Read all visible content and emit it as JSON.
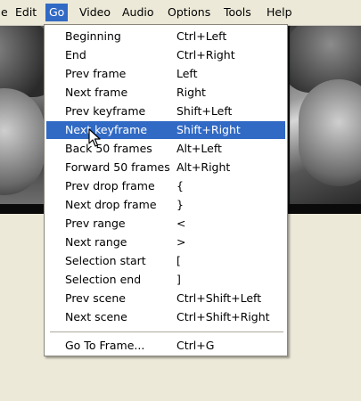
{
  "menubar": {
    "items": [
      {
        "label": "e"
      },
      {
        "label": "Edit"
      },
      {
        "label": "Go"
      },
      {
        "label": "Video"
      },
      {
        "label": "Audio"
      },
      {
        "label": "Options"
      },
      {
        "label": "Tools"
      },
      {
        "label": "Help"
      }
    ],
    "active_index": 2
  },
  "go_menu": {
    "items": [
      {
        "label": "Beginning",
        "shortcut": "Ctrl+Left"
      },
      {
        "label": "End",
        "shortcut": "Ctrl+Right"
      },
      {
        "label": "Prev frame",
        "shortcut": "Left"
      },
      {
        "label": "Next frame",
        "shortcut": "Right"
      },
      {
        "label": "Prev keyframe",
        "shortcut": "Shift+Left"
      },
      {
        "label": "Next keyframe",
        "shortcut": "Shift+Right"
      },
      {
        "label": "Back 50 frames",
        "shortcut": "Alt+Left"
      },
      {
        "label": "Forward 50 frames",
        "shortcut": "Alt+Right"
      },
      {
        "label": "Prev drop frame",
        "shortcut": "{"
      },
      {
        "label": "Next drop frame",
        "shortcut": "}"
      },
      {
        "label": "Prev range",
        "shortcut": "<"
      },
      {
        "label": "Next range",
        "shortcut": ">"
      },
      {
        "label": "Selection start",
        "shortcut": "["
      },
      {
        "label": "Selection end",
        "shortcut": "]"
      },
      {
        "label": "Prev scene",
        "shortcut": "Ctrl+Shift+Left"
      },
      {
        "label": "Next scene",
        "shortcut": "Ctrl+Shift+Right"
      }
    ],
    "highlighted_index": 5,
    "footer": {
      "label": "Go To Frame...",
      "shortcut": "Ctrl+G"
    }
  },
  "colors": {
    "highlight": "#316ac5",
    "menubar_bg": "#ece9d8",
    "menu_bg": "#ffffff"
  }
}
